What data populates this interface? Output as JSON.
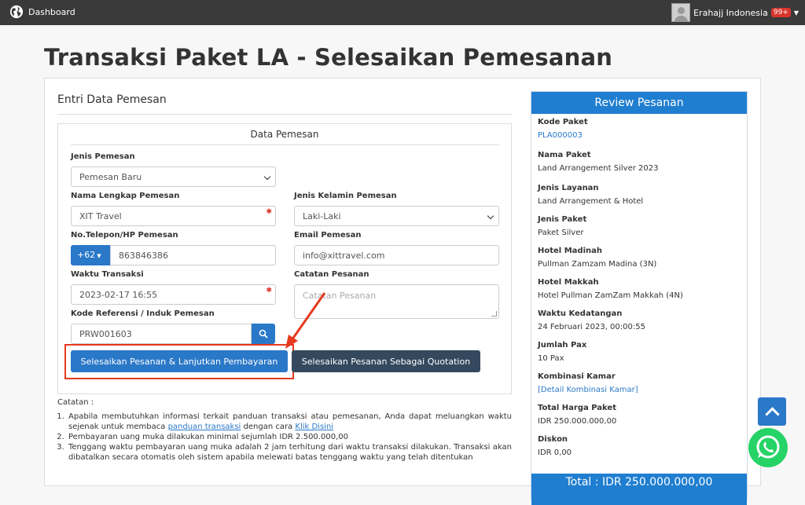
{
  "topbar": {
    "brand": "Dashboard",
    "user_name": "Erahajj Indonesia",
    "notification_count": "99+"
  },
  "page_title": "Transaksi Paket LA - Selesaikan Pemesanan",
  "entri": {
    "title": "Entri Data Pemesan",
    "box_title": "Data Pemesan",
    "fields": {
      "jenis_pemesan": {
        "label": "Jenis Pemesan",
        "value": "Pemesan Baru"
      },
      "nama_lengkap": {
        "label": "Nama Lengkap Pemesan",
        "value": "XIT Travel"
      },
      "jenis_kelamin": {
        "label": "Jenis Kelamin Pemesan",
        "value": "Laki-Laki"
      },
      "telepon": {
        "label": "No.Telepon/HP Pemesan",
        "prefix": "+62",
        "value": "863846386"
      },
      "email": {
        "label": "Email Pemesan",
        "value": "info@xittravel.com"
      },
      "waktu_transaksi": {
        "label": "Waktu Transaksi",
        "value": "2023-02-17 16:55"
      },
      "catatan_pesanan": {
        "label": "Catatan Pesanan",
        "placeholder": "Catatan Pesanan"
      },
      "kode_referensi": {
        "label": "Kode Referensi / Induk Pemesan",
        "value": "PRW001603"
      }
    },
    "buttons": {
      "finish_pay": "Selesaikan Pesanan & Lanjutkan Pembayaran",
      "finish_quote": "Selesaikan Pesanan Sebagai Quotation"
    }
  },
  "catatan": {
    "title": "Catatan :",
    "item1_pre": "Apabila membutuhkan informasi terkait panduan transaksi atau pemesanan, Anda dapat meluangkan waktu sejenak untuk membaca ",
    "item1_link1": "panduan transaksi",
    "item1_mid": " dengan cara ",
    "item1_link2": "Klik Disini",
    "item2": "Pembayaran uang muka dilakukan minimal sejumlah IDR 2.500.000,00",
    "item3": "Tenggang waktu pembayaran uang muka adalah 2 jam terhitung dari waktu transaksi dilakukan. Transaksi akan dibatalkan secara otomatis oleh sistem apabila melewati batas tenggang waktu yang telah ditentukan"
  },
  "review": {
    "title": "Review Pesanan",
    "items": [
      {
        "k": "Kode Paket",
        "v": "PLA000003"
      },
      {
        "k": "Nama Paket",
        "v": "Land Arrangement Silver 2023"
      },
      {
        "k": "Jenis Layanan",
        "v": "Land Arrangement & Hotel"
      },
      {
        "k": "Jenis Paket",
        "v": "Paket Silver"
      },
      {
        "k": "Hotel Madinah",
        "v": "Pullman Zamzam Madina (3N)"
      },
      {
        "k": "Hotel Makkah",
        "v": "Hotel Pullman ZamZam Makkah (4N)"
      },
      {
        "k": "Waktu Kedatangan",
        "v": "24 Februari 2023, 00:00:55"
      },
      {
        "k": "Jumlah Pax",
        "v": "10 Pax"
      },
      {
        "k": "Kombinasi Kamar",
        "v": "[Detail Kombinasi Kamar]"
      },
      {
        "k": "Total Harga Paket",
        "v": "IDR 250.000.000,00"
      },
      {
        "k": "Diskon",
        "v": "IDR 0,00"
      }
    ],
    "total": "Total : IDR 250.000.000,00"
  },
  "colors": {
    "primary": "#2a78c8",
    "topbar": "#3a3a3a",
    "highlight": "#e53a1e",
    "whatsapp": "#25d366"
  }
}
